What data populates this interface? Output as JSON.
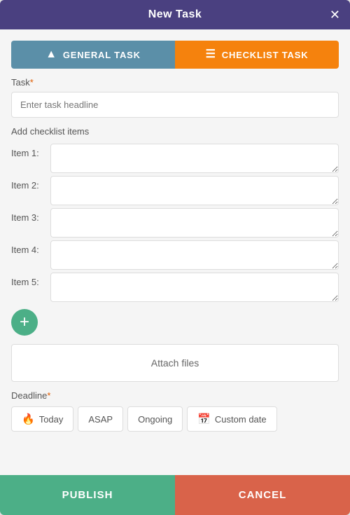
{
  "header": {
    "title": "New Task",
    "close_label": "✕"
  },
  "tabs": {
    "general_label": "GENERAL TASK",
    "checklist_label": "CHECKLIST TASK",
    "general_icon": "≡▲",
    "checklist_icon": "≡"
  },
  "task_field": {
    "label": "Task",
    "required": "*",
    "placeholder": "Enter task headline"
  },
  "checklist": {
    "section_label": "Add checklist items",
    "items": [
      {
        "label": "Item 1:"
      },
      {
        "label": "Item 2:"
      },
      {
        "label": "Item 3:"
      },
      {
        "label": "Item 4:"
      },
      {
        "label": "Item 5:"
      }
    ],
    "add_button_label": "+"
  },
  "attach": {
    "button_label": "Attach files"
  },
  "deadline": {
    "label": "Deadline",
    "required": "*",
    "options": [
      {
        "label": "Today",
        "icon": "fire"
      },
      {
        "label": "ASAP",
        "icon": "none"
      },
      {
        "label": "Ongoing",
        "icon": "none"
      },
      {
        "label": "Custom date",
        "icon": "calendar"
      }
    ]
  },
  "footer": {
    "publish_label": "PUBLISH",
    "cancel_label": "CANCEL"
  }
}
